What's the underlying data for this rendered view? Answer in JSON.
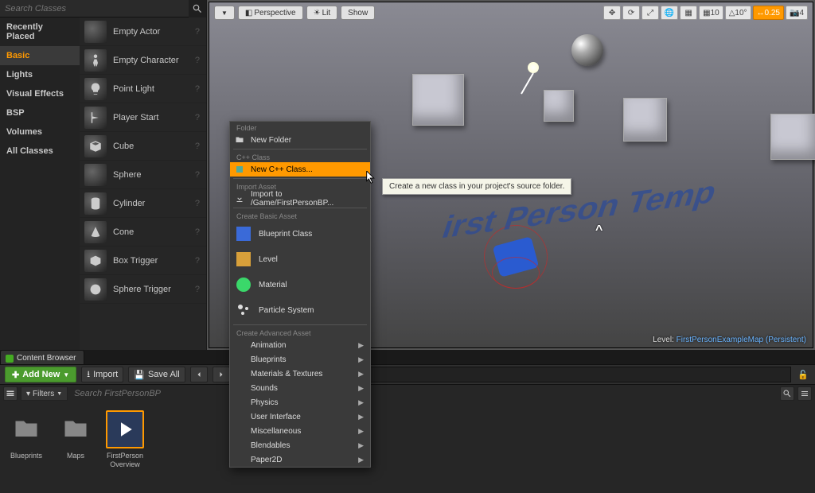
{
  "place_actors": {
    "search_placeholder": "Search Classes",
    "categories": [
      "Recently Placed",
      "Basic",
      "Lights",
      "Visual Effects",
      "BSP",
      "Volumes",
      "All Classes"
    ],
    "active_category": "Basic",
    "items": [
      {
        "label": "Empty Actor",
        "icon": "sphere"
      },
      {
        "label": "Empty Character",
        "icon": "person"
      },
      {
        "label": "Point Light",
        "icon": "bulb"
      },
      {
        "label": "Player Start",
        "icon": "flag"
      },
      {
        "label": "Cube",
        "icon": "cube"
      },
      {
        "label": "Sphere",
        "icon": "sphere"
      },
      {
        "label": "Cylinder",
        "icon": "cylinder"
      },
      {
        "label": "Cone",
        "icon": "cone"
      },
      {
        "label": "Box Trigger",
        "icon": "wirecube"
      },
      {
        "label": "Sphere Trigger",
        "icon": "wiresphere"
      }
    ]
  },
  "viewport": {
    "dropdown_buttons": [
      "Perspective",
      "Lit",
      "Show"
    ],
    "right_buttons": [
      {
        "icon": "move",
        "active": false
      },
      {
        "icon": "rotate",
        "active": false
      },
      {
        "icon": "scale",
        "active": false
      },
      {
        "icon": "globe",
        "active": false
      },
      {
        "icon": "snap",
        "active": false
      },
      {
        "icon": "grid",
        "active": true,
        "value": "10"
      },
      {
        "icon": "angle",
        "active": true,
        "value": "10°"
      },
      {
        "icon": "scale-snap",
        "active": true,
        "value": "0.25",
        "orange": true
      },
      {
        "icon": "camera",
        "value": "4"
      }
    ],
    "floor_text": "irst Person Temp",
    "level_label_prefix": "Level: ",
    "level_name": "FirstPersonExampleMap",
    "level_suffix": " (Persistent)"
  },
  "content_browser": {
    "tab_label": "Content Browser",
    "add_new": "Add New",
    "import": "Import",
    "save_all": "Save All",
    "path_placeholder": "",
    "filters_label": "Filters",
    "search_placeholder": "Search FirstPersonBP",
    "assets": [
      {
        "label": "Blueprints",
        "type": "folder"
      },
      {
        "label": "Maps",
        "type": "folder"
      },
      {
        "label": "FirstPerson Overview",
        "type": "tutorial",
        "selected": true
      }
    ]
  },
  "context_menu": {
    "sections": [
      {
        "header": "Folder",
        "items": [
          {
            "label": "New Folder",
            "icon": "folder-plus"
          }
        ]
      },
      {
        "header": "C++ Class",
        "items": [
          {
            "label": "New C++ Class...",
            "icon": "cpp",
            "highlight": true
          }
        ]
      },
      {
        "header": "Import Asset",
        "items": [
          {
            "label": "Import to /Game/FirstPersonBP...",
            "icon": "import"
          }
        ]
      },
      {
        "header": "Create Basic Asset",
        "items": [
          {
            "label": "Blueprint Class",
            "icon": "blueprint",
            "tall": true
          },
          {
            "label": "Level",
            "icon": "level",
            "tall": true
          },
          {
            "label": "Material",
            "icon": "material",
            "tall": true
          },
          {
            "label": "Particle System",
            "icon": "particle",
            "tall": true
          }
        ]
      },
      {
        "header": "Create Advanced Asset",
        "items": [
          {
            "label": "Animation",
            "submenu": true
          },
          {
            "label": "Blueprints",
            "submenu": true
          },
          {
            "label": "Materials & Textures",
            "submenu": true
          },
          {
            "label": "Sounds",
            "submenu": true
          },
          {
            "label": "Physics",
            "submenu": true
          },
          {
            "label": "User Interface",
            "submenu": true
          },
          {
            "label": "Miscellaneous",
            "submenu": true
          },
          {
            "label": "Blendables",
            "submenu": true
          },
          {
            "label": "Paper2D",
            "submenu": true
          }
        ]
      }
    ]
  },
  "tooltip": "Create a new class in your project's source folder."
}
